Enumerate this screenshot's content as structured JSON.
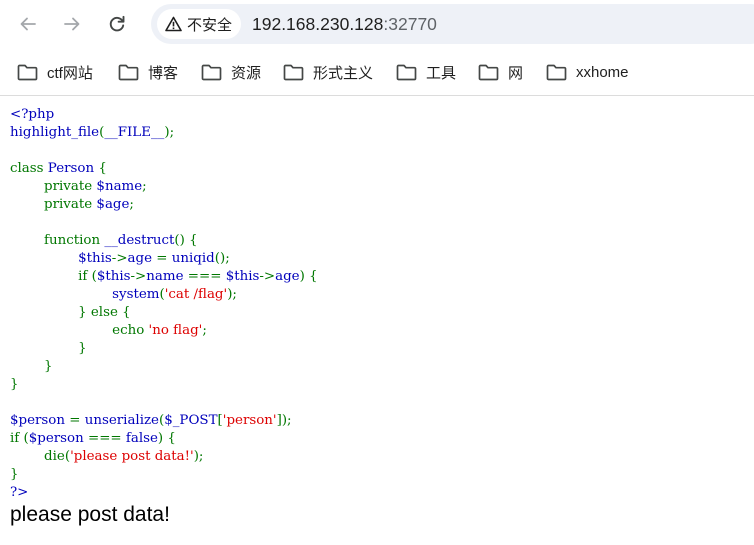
{
  "browser": {
    "security_label": "不安全",
    "url_host": "192.168.230.128",
    "url_port": ":32770",
    "bookmarks": [
      {
        "label": "ctf网站"
      },
      {
        "label": "博客"
      },
      {
        "label": "资源"
      },
      {
        "label": "形式主义"
      },
      {
        "label": "工具"
      },
      {
        "label": "网"
      },
      {
        "label": "xxhome"
      }
    ]
  },
  "colors": {
    "php_default": "#0000bb",
    "php_keyword": "#007700",
    "php_string": "#dd0000"
  },
  "code_lines": [
    [
      {
        "t": "<?php",
        "c": "d"
      }
    ],
    [
      {
        "t": "highlight_file",
        "c": "d"
      },
      {
        "t": "(",
        "c": "k"
      },
      {
        "t": "__FILE__",
        "c": "d"
      },
      {
        "t": ");",
        "c": "k"
      }
    ],
    [],
    [
      {
        "t": "class ",
        "c": "k"
      },
      {
        "t": "Person ",
        "c": "d"
      },
      {
        "t": "{",
        "c": "k"
      }
    ],
    [
      {
        "t": "        private ",
        "c": "k"
      },
      {
        "t": "$name",
        "c": "d"
      },
      {
        "t": ";",
        "c": "k"
      }
    ],
    [
      {
        "t": "        private ",
        "c": "k"
      },
      {
        "t": "$age",
        "c": "d"
      },
      {
        "t": ";",
        "c": "k"
      }
    ],
    [],
    [
      {
        "t": "        function ",
        "c": "k"
      },
      {
        "t": "__destruct",
        "c": "d"
      },
      {
        "t": "() {",
        "c": "k"
      }
    ],
    [
      {
        "t": "                ",
        "c": "k"
      },
      {
        "t": "$this",
        "c": "d"
      },
      {
        "t": "->",
        "c": "k"
      },
      {
        "t": "age ",
        "c": "d"
      },
      {
        "t": "= ",
        "c": "k"
      },
      {
        "t": "uniqid",
        "c": "d"
      },
      {
        "t": "();",
        "c": "k"
      }
    ],
    [
      {
        "t": "                if (",
        "c": "k"
      },
      {
        "t": "$this",
        "c": "d"
      },
      {
        "t": "->",
        "c": "k"
      },
      {
        "t": "name ",
        "c": "d"
      },
      {
        "t": "=== ",
        "c": "k"
      },
      {
        "t": "$this",
        "c": "d"
      },
      {
        "t": "->",
        "c": "k"
      },
      {
        "t": "age",
        "c": "d"
      },
      {
        "t": ") {",
        "c": "k"
      }
    ],
    [
      {
        "t": "                        ",
        "c": "k"
      },
      {
        "t": "system",
        "c": "d"
      },
      {
        "t": "(",
        "c": "k"
      },
      {
        "t": "'cat /flag'",
        "c": "s"
      },
      {
        "t": ");",
        "c": "k"
      }
    ],
    [
      {
        "t": "                } else {",
        "c": "k"
      }
    ],
    [
      {
        "t": "                        echo ",
        "c": "k"
      },
      {
        "t": "'no flag'",
        "c": "s"
      },
      {
        "t": ";",
        "c": "k"
      }
    ],
    [
      {
        "t": "                }",
        "c": "k"
      }
    ],
    [
      {
        "t": "        }",
        "c": "k"
      }
    ],
    [
      {
        "t": "}",
        "c": "k"
      }
    ],
    [],
    [
      {
        "t": "$person ",
        "c": "d"
      },
      {
        "t": "= ",
        "c": "k"
      },
      {
        "t": "unserialize",
        "c": "d"
      },
      {
        "t": "(",
        "c": "k"
      },
      {
        "t": "$_POST",
        "c": "d"
      },
      {
        "t": "[",
        "c": "k"
      },
      {
        "t": "'person'",
        "c": "s"
      },
      {
        "t": "]);",
        "c": "k"
      }
    ],
    [
      {
        "t": "if (",
        "c": "k"
      },
      {
        "t": "$person ",
        "c": "d"
      },
      {
        "t": "=== ",
        "c": "k"
      },
      {
        "t": "false",
        "c": "d"
      },
      {
        "t": ") {",
        "c": "k"
      }
    ],
    [
      {
        "t": "        die",
        "c": "k"
      },
      {
        "t": "(",
        "c": "k"
      },
      {
        "t": "'please post data!'",
        "c": "s"
      },
      {
        "t": ");",
        "c": "k"
      }
    ],
    [
      {
        "t": "}",
        "c": "k"
      }
    ],
    [
      {
        "t": "?>",
        "c": "d"
      }
    ]
  ],
  "page_output": "please post data!"
}
